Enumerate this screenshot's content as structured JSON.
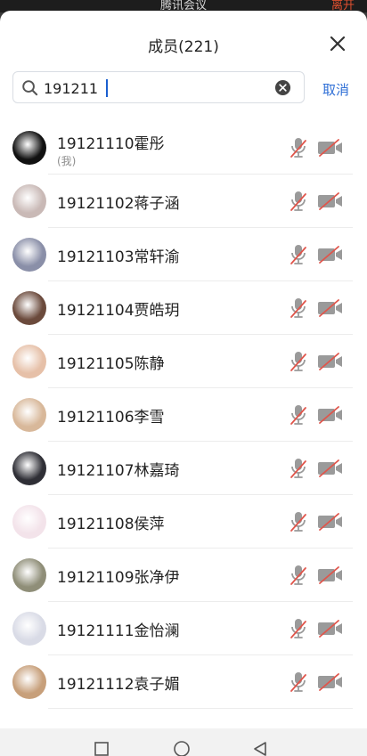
{
  "background": {
    "meeting_title": "腾讯会议",
    "leave_label": "离开"
  },
  "header": {
    "title": "成员(221)",
    "close_icon": "close-icon"
  },
  "search": {
    "value": "191211",
    "icon": "search-icon",
    "clear_icon": "clear-circle-icon",
    "cancel_label": "取消"
  },
  "members": [
    {
      "name": "19121110霍彤",
      "tag": "(我)",
      "avatar_color": "#111111"
    },
    {
      "name": "19121102蒋子涵",
      "avatar_color": "#c9b9b6"
    },
    {
      "name": "19121103常轩渝",
      "avatar_color": "#8a8fa8"
    },
    {
      "name": "19121104贾皓玥",
      "avatar_color": "#6b4a3c"
    },
    {
      "name": "19121105陈静",
      "avatar_color": "#e6c0a8"
    },
    {
      "name": "19121106李雪",
      "avatar_color": "#d8b89a"
    },
    {
      "name": "19121107林嘉琦",
      "avatar_color": "#2f2f36"
    },
    {
      "name": "19121108侯萍",
      "avatar_color": "#f3e3ea"
    },
    {
      "name": "19121109张净伊",
      "avatar_color": "#8f8e78"
    },
    {
      "name": "19121111金怡澜",
      "avatar_color": "#d9dbe6"
    },
    {
      "name": "19121112袁子媚",
      "avatar_color": "#c79f7a"
    }
  ],
  "colors": {
    "accent": "#2f6fd6",
    "mute_slash": "#e0554b",
    "icon_gray": "#9a9a9a"
  },
  "navbar": {
    "recent_icon": "square-icon",
    "home_icon": "circle-icon",
    "back_icon": "triangle-back-icon"
  }
}
